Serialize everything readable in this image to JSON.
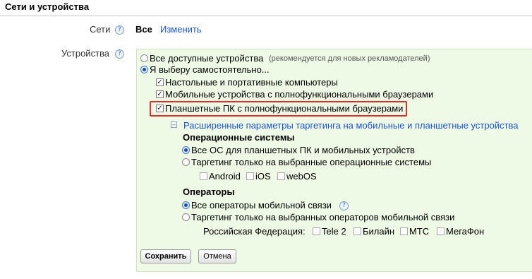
{
  "section": {
    "title": "Сети и устройства"
  },
  "networks": {
    "label": "Сети",
    "help": "?",
    "value": "Все",
    "change_link": "Изменить"
  },
  "devices": {
    "label": "Устройства",
    "help": "?",
    "all_devices": {
      "label": "Все доступные устройства",
      "hint": "(рекомендуется для новых рекламодателей)",
      "selected": false
    },
    "custom": {
      "label": "Я выберу самостоятельно...",
      "selected": true
    },
    "desktop": {
      "label": "Настольные и портативные компьютеры",
      "checked": true
    },
    "mobile": {
      "label": "Мобильные устройства с полнофункциональными браузерами",
      "checked": true
    },
    "tablet": {
      "label": "Планшетные ПК с полнофункциональными браузерами",
      "checked": true
    },
    "advanced_toggle": {
      "icon": "minus-icon",
      "label": "Расширенные параметры таргетинга на мобильные и планшетные устройства"
    },
    "os": {
      "heading": "Операционные системы",
      "all": {
        "label": "Все ОС для планшетных ПК и мобильных устройств",
        "selected": true
      },
      "specific": {
        "label": "Таргетинг только на выбранные операционные системы",
        "selected": false
      },
      "options": [
        {
          "label": "Android",
          "checked": false
        },
        {
          "label": "iOS",
          "checked": false
        },
        {
          "label": "webOS",
          "checked": false
        }
      ]
    },
    "carriers": {
      "heading": "Операторы",
      "all": {
        "label": "Все операторы мобильной связи",
        "selected": true,
        "help": "?"
      },
      "specific": {
        "label": "Таргетинг только на выбранных операторов мобильной связи",
        "selected": false
      },
      "country": "Российская Федерация:",
      "options": [
        {
          "label": "Tele 2",
          "checked": false
        },
        {
          "label": "Билайн",
          "checked": false
        },
        {
          "label": "МТС",
          "checked": false
        },
        {
          "label": "МегаФон",
          "checked": false
        }
      ]
    }
  },
  "buttons": {
    "save": "Сохранить",
    "cancel": "Отмена"
  },
  "colors": {
    "panel_bg": "#eef9e6",
    "link": "#1a55c4",
    "highlight": "#d9302c"
  }
}
